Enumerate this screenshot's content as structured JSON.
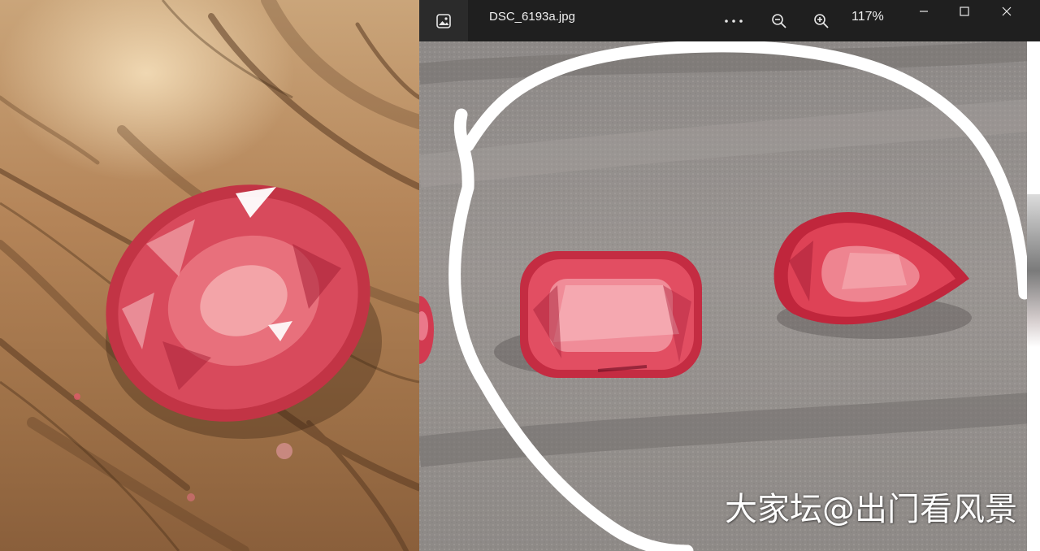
{
  "viewer": {
    "file_name": "DSC_6193a.jpg",
    "zoom_level": "117%"
  },
  "icons": {
    "app": "photos-icon",
    "more": "more-icon",
    "zoom_out": "zoom-out-icon",
    "zoom_in": "zoom-in-icon",
    "minimize": "minimize-icon",
    "maximize": "maximize-icon",
    "close": "close-icon"
  },
  "watermark": "大家坛@出门看风景",
  "colors": {
    "titlebar": "#1f1f1f",
    "gem_red": "#d8324a",
    "felt_gray": "#9a9592"
  }
}
